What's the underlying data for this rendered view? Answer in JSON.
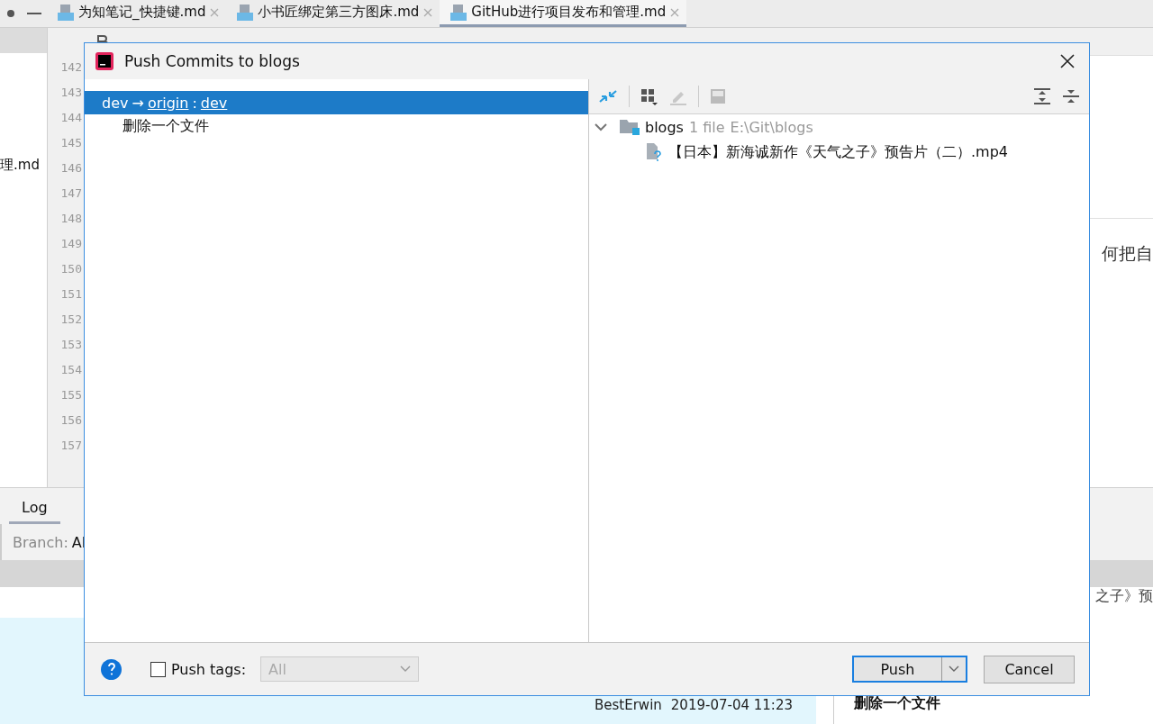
{
  "editor_tabs": [
    {
      "label": "为知笔记_快捷键.md",
      "selected": false
    },
    {
      "label": "小书匠绑定第三方图床.md",
      "selected": false
    },
    {
      "label": "GitHub进行项目发布和管理.md",
      "selected": true
    }
  ],
  "sidebar_fragment": "理.md",
  "line_numbers": [
    "142",
    "143",
    "144",
    "145",
    "146",
    "147",
    "148",
    "149",
    "150",
    "151",
    "152",
    "153",
    "154",
    "155",
    "156",
    "157"
  ],
  "editor_fragment": "何把自",
  "bottom_panel": {
    "tabs": [
      {
        "label": "Log",
        "selected": true
      }
    ],
    "branch_label": "Branch:",
    "branch_value": "Al",
    "commit_row": {
      "author": "BestErwin",
      "date": "2019-07-04 11:23"
    },
    "details_fragment": "之子》预",
    "details_title": "删除一个文件"
  },
  "dialog": {
    "title": "Push Commits to blogs",
    "branch_row": {
      "local": "dev",
      "arrow": "→",
      "remote": "origin",
      "separator": ":",
      "remote_branch": "dev",
      "selected": true
    },
    "commits": [
      {
        "message": "删除一个文件"
      }
    ],
    "tree": {
      "expanded": true,
      "name": "blogs",
      "count": "1 file",
      "path": "E:\\Git\\blogs",
      "children": [
        {
          "name": "【日本】新海诚新作《天气之子》预告片（二）.mp4"
        }
      ]
    },
    "push_tags": {
      "label": "Push tags:",
      "checked": false,
      "dropdown": "All",
      "disabled": true
    },
    "buttons": {
      "push": "Push",
      "cancel": "Cancel"
    }
  }
}
